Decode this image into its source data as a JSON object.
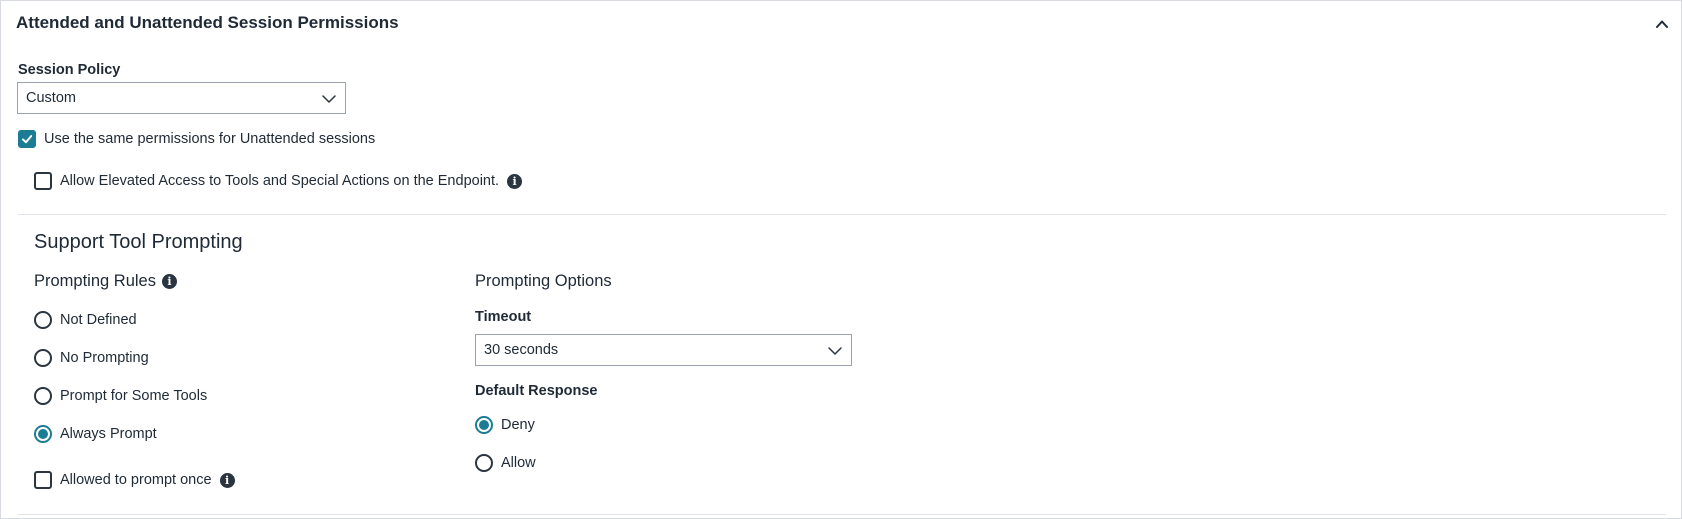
{
  "panel": {
    "title": "Attended and Unattended Session Permissions",
    "collapse_icon": "chevron-up-icon"
  },
  "session_policy": {
    "label": "Session Policy",
    "value": "Custom"
  },
  "same_permissions": {
    "label": "Use the same permissions for Unattended sessions",
    "checked": true
  },
  "elevated_access": {
    "label": "Allow Elevated Access to Tools and Special Actions on the Endpoint.",
    "checked": false,
    "info_icon": "info-icon"
  },
  "support_tool_prompting": {
    "heading": "Support Tool Prompting",
    "prompting_rules": {
      "heading": "Prompting Rules",
      "options": [
        {
          "label": "Not Defined",
          "selected": false
        },
        {
          "label": "No Prompting",
          "selected": false
        },
        {
          "label": "Prompt for Some Tools",
          "selected": false
        },
        {
          "label": "Always Prompt",
          "selected": true
        }
      ],
      "allowed_once": {
        "label": "Allowed to prompt once",
        "checked": false
      }
    },
    "prompting_options": {
      "heading": "Prompting Options",
      "timeout": {
        "label": "Timeout",
        "value": "30 seconds"
      },
      "default_response": {
        "label": "Default Response",
        "options": [
          {
            "label": "Deny",
            "selected": true
          },
          {
            "label": "Allow",
            "selected": false
          }
        ]
      }
    }
  },
  "colors": {
    "accent": "#1b7c93",
    "text": "#1f2a36",
    "border": "#d7dbe0"
  }
}
